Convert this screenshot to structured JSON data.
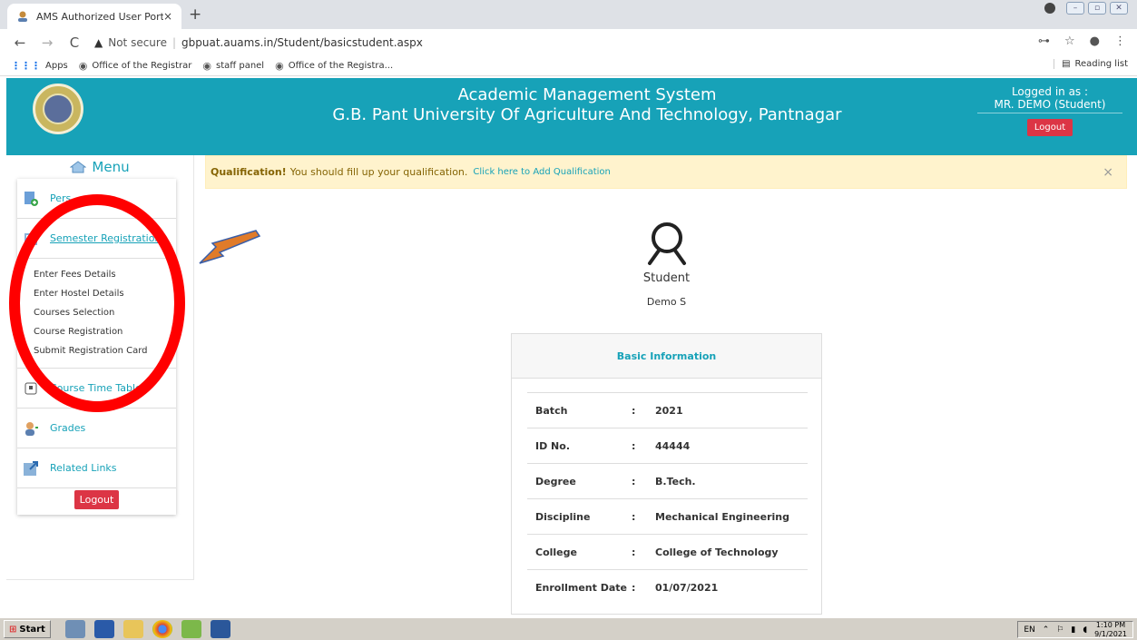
{
  "browser": {
    "tab_title": "AMS Authorized User Portal",
    "new_tab": "+",
    "tab_close": "×",
    "nav_back": "←",
    "nav_forward": "→",
    "nav_reload": "C",
    "url_warning": "Not secure",
    "url": "gbpuat.auams.in/Student/basicstudent.aspx",
    "bookmarks": [
      {
        "label": "Apps"
      },
      {
        "label": "Office of the Registrar"
      },
      {
        "label": "staff panel"
      },
      {
        "label": "Office of the Registra..."
      }
    ],
    "reading_list": "Reading list"
  },
  "header": {
    "title_line1": "Academic Management System",
    "title_line2": "G.B. Pant University Of Agriculture And Technology, Pantnagar",
    "logged_in_label": "Logged in as :",
    "user": "MR. DEMO (Student)",
    "logout": "Logout",
    "color": "#17a2b8"
  },
  "sidebar": {
    "menu_title": "Menu",
    "items": [
      {
        "label": "Pers",
        "icon": "add-file-icon"
      },
      {
        "label": "Semester Registration",
        "icon": "building-icon"
      },
      {
        "label": "Course Time Table",
        "icon": "calendar-icon"
      },
      {
        "label": "Grades",
        "icon": "user-icon"
      },
      {
        "label": "Related Links",
        "icon": "link-icon"
      }
    ],
    "submenu": [
      "Enter Fees Details",
      "Enter Hostel Details",
      "Courses Selection",
      "Course Registration",
      "Submit Registration Card"
    ],
    "logout": "Logout"
  },
  "alert": {
    "bold": "Qualification!",
    "text": "You should fill up your qualification.",
    "link": "Click here to Add Qualification",
    "close": "×"
  },
  "profile": {
    "role": "Student",
    "name": "Demo S"
  },
  "basic_info": {
    "title": "Basic Information",
    "rows": [
      {
        "key": "Batch",
        "value": "2021"
      },
      {
        "key": "ID No.",
        "value": "44444"
      },
      {
        "key": "Degree",
        "value": "B.Tech."
      },
      {
        "key": "Discipline",
        "value": "Mechanical Engineering"
      },
      {
        "key": "College",
        "value": "College of Technology"
      },
      {
        "key": "Enrollment Date",
        "value": "01/07/2021"
      }
    ],
    "colon": ":"
  },
  "taskbar": {
    "start": "Start",
    "lang": "EN",
    "time": "1:10 PM",
    "date": "9/1/2021"
  }
}
